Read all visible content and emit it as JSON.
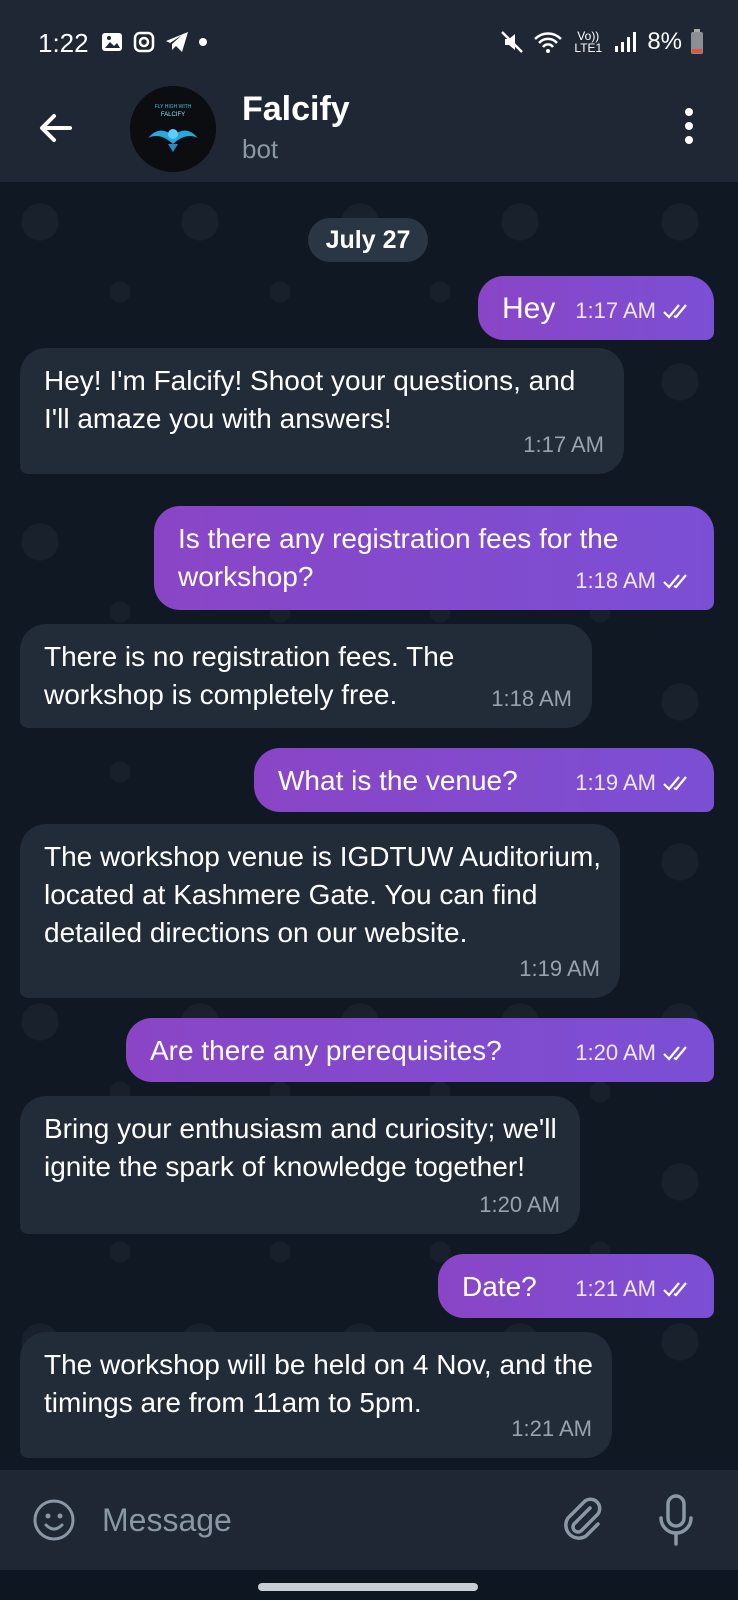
{
  "status_bar": {
    "time": "1:22",
    "battery": "8%",
    "network": "Vo)) LTE1"
  },
  "header": {
    "title": "Falcify",
    "subtitle": "bot",
    "avatar_text_top": "FLY HIGH WITH",
    "avatar_text_bottom": "FALCIFY"
  },
  "chat": {
    "date_chip": "July 27",
    "messages": [
      {
        "dir": "out",
        "text": "Hey",
        "time": "1:17 AM"
      },
      {
        "dir": "in",
        "text": "Hey! I'm Falcify! Shoot your questions, and I'll amaze you with answers!",
        "time": "1:17 AM"
      },
      {
        "dir": "out",
        "text": "Is there any registration fees for the workshop?",
        "time": "1:18 AM"
      },
      {
        "dir": "in",
        "text": "There is no registration fees. The workshop is completely free.",
        "time": "1:18 AM"
      },
      {
        "dir": "out",
        "text": "What is the venue?",
        "time": "1:19 AM"
      },
      {
        "dir": "in",
        "text": "The workshop venue is IGDTUW Auditorium, located at Kashmere Gate. You can find detailed directions on our website.",
        "time": "1:19 AM"
      },
      {
        "dir": "out",
        "text": "Are there any prerequisites?",
        "time": "1:20 AM"
      },
      {
        "dir": "in",
        "text": "Bring your enthusiasm and curiosity; we'll ignite the spark of knowledge together!",
        "time": "1:20 AM"
      },
      {
        "dir": "out",
        "text": "Date?",
        "time": "1:21 AM"
      },
      {
        "dir": "in",
        "text": "The workshop will be held on 4 Nov, and the timings are from 11am to 5pm.",
        "time": "1:21 AM"
      }
    ]
  },
  "composer": {
    "placeholder": "Message"
  },
  "colors": {
    "background": "#0e1621",
    "bar": "#1e2733",
    "incoming_bubble": "#222c38",
    "outgoing_start": "#8a45c6",
    "outgoing_end": "#7b4fd4"
  }
}
